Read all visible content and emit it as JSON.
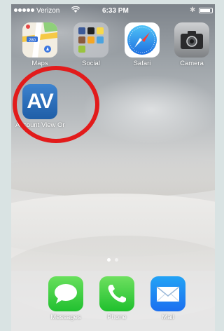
{
  "status_bar": {
    "carrier": "Verizon",
    "time": "6:33 PM",
    "signal_bars": 5,
    "battery_level": 0.9
  },
  "apps": [
    {
      "label": "Maps",
      "icon": "maps-icon"
    },
    {
      "label": "Social",
      "icon": "social-folder-icon"
    },
    {
      "label": "Safari",
      "icon": "safari-icon"
    },
    {
      "label": "Camera",
      "icon": "camera-icon"
    },
    {
      "label": "Account View Or",
      "icon_text": "AV",
      "icon": "account-view-icon"
    }
  ],
  "dock": [
    {
      "label": "Messages",
      "icon": "messages-icon"
    },
    {
      "label": "Phone",
      "icon": "phone-icon"
    },
    {
      "label": "Mail",
      "icon": "mail-icon"
    }
  ],
  "page_indicator": {
    "pages": 2,
    "current": 1
  },
  "colors": {
    "highlight_circle": "#e21b1b",
    "av_icon_blue": "#2b6db8"
  }
}
